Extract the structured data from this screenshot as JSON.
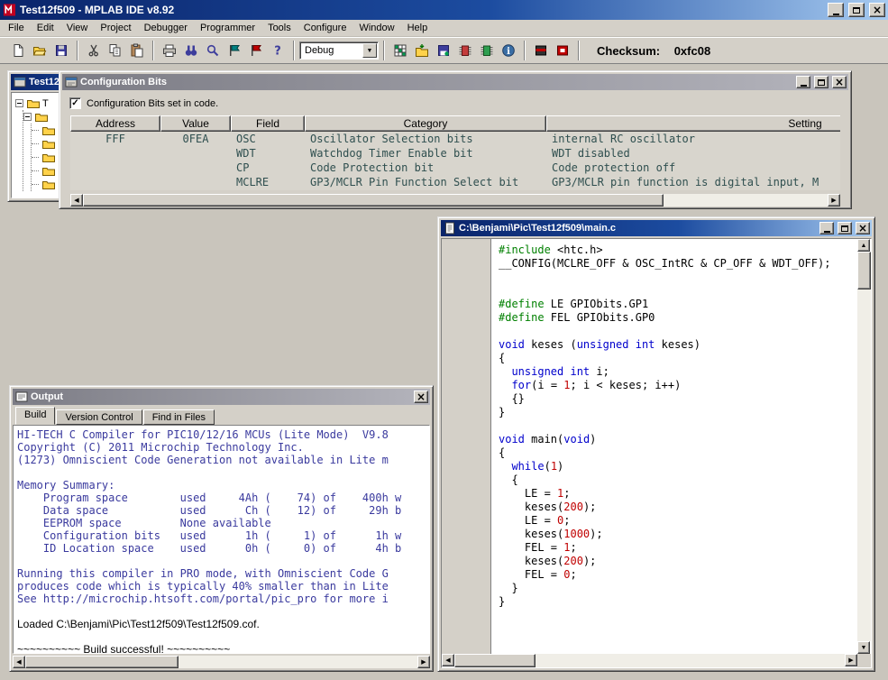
{
  "app": {
    "title": "Test12f509 - MPLAB IDE v8.92",
    "debug_combo_value": "Debug",
    "checksum_label": "Checksum:",
    "checksum_value": "0xfc08"
  },
  "menu": [
    "File",
    "Edit",
    "View",
    "Project",
    "Debugger",
    "Programmer",
    "Tools",
    "Configure",
    "Window",
    "Help"
  ],
  "toolbar_icons": {
    "file": [
      "new-file",
      "open-file",
      "save-file"
    ],
    "edit": [
      "cut",
      "copy",
      "paste"
    ],
    "search": [
      "print",
      "find",
      "find-next",
      "bookmark-teal",
      "bookmark-red",
      "help"
    ],
    "debug": [
      "grid",
      "folder-import",
      "save-disk",
      "chip-red",
      "chip-green",
      "info"
    ],
    "programmer": [
      "chip-black",
      "chip-red-solid"
    ]
  },
  "project_window": {
    "title": "Test12",
    "root_label": "T",
    "sub_label": "",
    "child_folders": 5
  },
  "config_window": {
    "title": "Configuration Bits",
    "checkbox_label": "Configuration Bits set in code.",
    "checkbox_checked": true,
    "table": {
      "headers": [
        "Address",
        "Value",
        "Field",
        "Category",
        "Setting"
      ],
      "rows": [
        [
          "FFF",
          "0FEA",
          "OSC",
          "Oscillator Selection bits",
          "internal RC oscillator"
        ],
        [
          "",
          "",
          "WDT",
          "Watchdog Timer Enable bit",
          "WDT disabled"
        ],
        [
          "",
          "",
          "CP",
          "Code Protection bit",
          "Code protection off"
        ],
        [
          "",
          "",
          "MCLRE",
          "GP3/MCLR Pin Function Select bit",
          "GP3/MCLR pin function is digital input, M"
        ]
      ]
    }
  },
  "editor_window": {
    "title": "C:\\Benjami\\Pic\\Test12f509\\main.c",
    "code_lines": [
      [
        [
          "d",
          "#include"
        ],
        [
          "p",
          " <htc.h>"
        ]
      ],
      [
        [
          "p",
          "__CONFIG(MCLRE_OFF & OSC_IntRC & CP_OFF & WDT_OFF);"
        ]
      ],
      [],
      [],
      [
        [
          "d",
          "#define"
        ],
        [
          "p",
          " LE GPIObits.GP1"
        ]
      ],
      [
        [
          "d",
          "#define"
        ],
        [
          "p",
          " FEL GPIObits.GP0"
        ]
      ],
      [],
      [
        [
          "k",
          "void"
        ],
        [
          "p",
          " keses ("
        ],
        [
          "k",
          "unsigned"
        ],
        [
          "p",
          " "
        ],
        [
          "k",
          "int"
        ],
        [
          "p",
          " keses)"
        ]
      ],
      [
        [
          "p",
          "{"
        ]
      ],
      [
        [
          "p",
          "  "
        ],
        [
          "k",
          "unsigned"
        ],
        [
          "p",
          " "
        ],
        [
          "k",
          "int"
        ],
        [
          "p",
          " i;"
        ]
      ],
      [
        [
          "p",
          "  "
        ],
        [
          "k",
          "for"
        ],
        [
          "p",
          "(i = "
        ],
        [
          "n",
          "1"
        ],
        [
          "p",
          "; i < keses; i++)"
        ]
      ],
      [
        [
          "p",
          "  {}"
        ]
      ],
      [
        [
          "p",
          "}"
        ]
      ],
      [],
      [
        [
          "k",
          "void"
        ],
        [
          "p",
          " main("
        ],
        [
          "k",
          "void"
        ],
        [
          "p",
          ")"
        ]
      ],
      [
        [
          "p",
          "{"
        ]
      ],
      [
        [
          "p",
          "  "
        ],
        [
          "k",
          "while"
        ],
        [
          "p",
          "("
        ],
        [
          "n",
          "1"
        ],
        [
          "p",
          ")"
        ]
      ],
      [
        [
          "p",
          "  {"
        ]
      ],
      [
        [
          "p",
          "    LE = "
        ],
        [
          "n",
          "1"
        ],
        [
          "p",
          ";"
        ]
      ],
      [
        [
          "p",
          "    keses("
        ],
        [
          "n",
          "200"
        ],
        [
          "p",
          ");"
        ]
      ],
      [
        [
          "p",
          "    LE = "
        ],
        [
          "n",
          "0"
        ],
        [
          "p",
          ";"
        ]
      ],
      [
        [
          "p",
          "    keses("
        ],
        [
          "n",
          "1000"
        ],
        [
          "p",
          ");"
        ]
      ],
      [
        [
          "p",
          "    FEL = "
        ],
        [
          "n",
          "1"
        ],
        [
          "p",
          ";"
        ]
      ],
      [
        [
          "p",
          "    keses("
        ],
        [
          "n",
          "200"
        ],
        [
          "p",
          ");"
        ]
      ],
      [
        [
          "p",
          "    FEL = "
        ],
        [
          "n",
          "0"
        ],
        [
          "p",
          ";"
        ]
      ],
      [
        [
          "p",
          "  }"
        ]
      ],
      [
        [
          "p",
          "}"
        ]
      ]
    ]
  },
  "output_window": {
    "title": "Output",
    "tabs": [
      "Build",
      "Version Control",
      "Find in Files"
    ],
    "active_tab": "Build",
    "lines": [
      [
        "b",
        "HI-TECH C Compiler for PIC10/12/16 MCUs (Lite Mode)  V9.8"
      ],
      [
        "b",
        "Copyright (C) 2011 Microchip Technology Inc."
      ],
      [
        "b",
        "(1273) Omniscient Code Generation not available in Lite m"
      ],
      [
        "b",
        ""
      ],
      [
        "b",
        "Memory Summary:"
      ],
      [
        "b",
        "    Program space        used     4Ah (    74) of    400h w"
      ],
      [
        "b",
        "    Data space           used      Ch (    12) of     29h b"
      ],
      [
        "b",
        "    EEPROM space         None available"
      ],
      [
        "b",
        "    Configuration bits   used      1h (     1) of      1h w"
      ],
      [
        "b",
        "    ID Location space    used      0h (     0) of      4h b"
      ],
      [
        "b",
        ""
      ],
      [
        "b",
        "Running this compiler in PRO mode, with Omniscient Code G"
      ],
      [
        "b",
        "produces code which is typically 40% smaller than in Lite"
      ],
      [
        "b",
        "See http://microchip.htsoft.com/portal/pic_pro for more i"
      ],
      [
        "k",
        ""
      ],
      [
        "k",
        "Loaded C:\\Benjami\\Pic\\Test12f509\\Test12f509.cof."
      ],
      [
        "k",
        ""
      ],
      [
        "k",
        "~~~~~~~~~~ Build successful! ~~~~~~~~~~"
      ]
    ]
  },
  "colors": {
    "titlebar_active_start": "#0a246a",
    "titlebar_active_end": "#a6caf0",
    "chrome": "#d4d0c8",
    "keyword": "#0000cc",
    "preprocessor": "#008000",
    "number": "#c00000",
    "compiler_output_text": "#3a3a9e",
    "config_table_text": "#2f4f4f"
  }
}
